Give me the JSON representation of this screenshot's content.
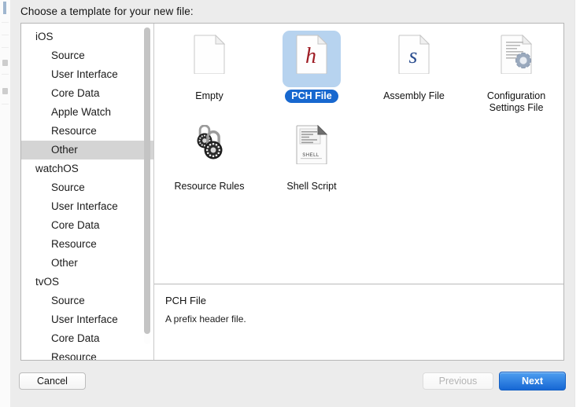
{
  "dialog": {
    "title": "Choose a template for your new file:"
  },
  "sidebar": {
    "items": [
      {
        "label": "iOS",
        "level": "group",
        "selected": false
      },
      {
        "label": "Source",
        "level": "child",
        "selected": false
      },
      {
        "label": "User Interface",
        "level": "child",
        "selected": false
      },
      {
        "label": "Core Data",
        "level": "child",
        "selected": false
      },
      {
        "label": "Apple Watch",
        "level": "child",
        "selected": false
      },
      {
        "label": "Resource",
        "level": "child",
        "selected": false
      },
      {
        "label": "Other",
        "level": "child",
        "selected": true
      },
      {
        "label": "watchOS",
        "level": "group",
        "selected": false
      },
      {
        "label": "Source",
        "level": "child",
        "selected": false
      },
      {
        "label": "User Interface",
        "level": "child",
        "selected": false
      },
      {
        "label": "Core Data",
        "level": "child",
        "selected": false
      },
      {
        "label": "Resource",
        "level": "child",
        "selected": false
      },
      {
        "label": "Other",
        "level": "child",
        "selected": false
      },
      {
        "label": "tvOS",
        "level": "group",
        "selected": false
      },
      {
        "label": "Source",
        "level": "child",
        "selected": false
      },
      {
        "label": "User Interface",
        "level": "child",
        "selected": false
      },
      {
        "label": "Core Data",
        "level": "child",
        "selected": false
      },
      {
        "label": "Resource",
        "level": "child",
        "selected": false
      }
    ],
    "scrollbar": "vertical-scrollbar"
  },
  "templates": {
    "rows": [
      [
        {
          "label": "Empty",
          "icon": "blank-document-icon",
          "selected": false
        },
        {
          "label": "PCH File",
          "icon": "header-file-icon",
          "selected": true
        },
        {
          "label": "Assembly File",
          "icon": "assembly-file-icon",
          "selected": false
        },
        {
          "label": "Configuration Settings File",
          "icon": "configuration-settings-icon",
          "selected": false
        }
      ],
      [
        {
          "label": "Resource Rules",
          "icon": "padlocks-icon",
          "selected": false
        },
        {
          "label": "Shell Script",
          "icon": "shell-script-icon",
          "selected": false
        }
      ]
    ],
    "glyphs": {
      "pch": "h",
      "assembly": "s",
      "shell": "SHELL"
    }
  },
  "description": {
    "title": "PCH File",
    "body": "A prefix header file."
  },
  "buttons": {
    "cancel": "Cancel",
    "previous": "Previous",
    "next": "Next"
  },
  "colors": {
    "accent_blue": "#1868cf",
    "selection_fill": "#b7d3ef",
    "sidebar_selection": "#d4d4d4",
    "pch_letter": "#9e1c24",
    "assembly_letter": "#2a4d8f",
    "window_bg": "#ececec"
  }
}
